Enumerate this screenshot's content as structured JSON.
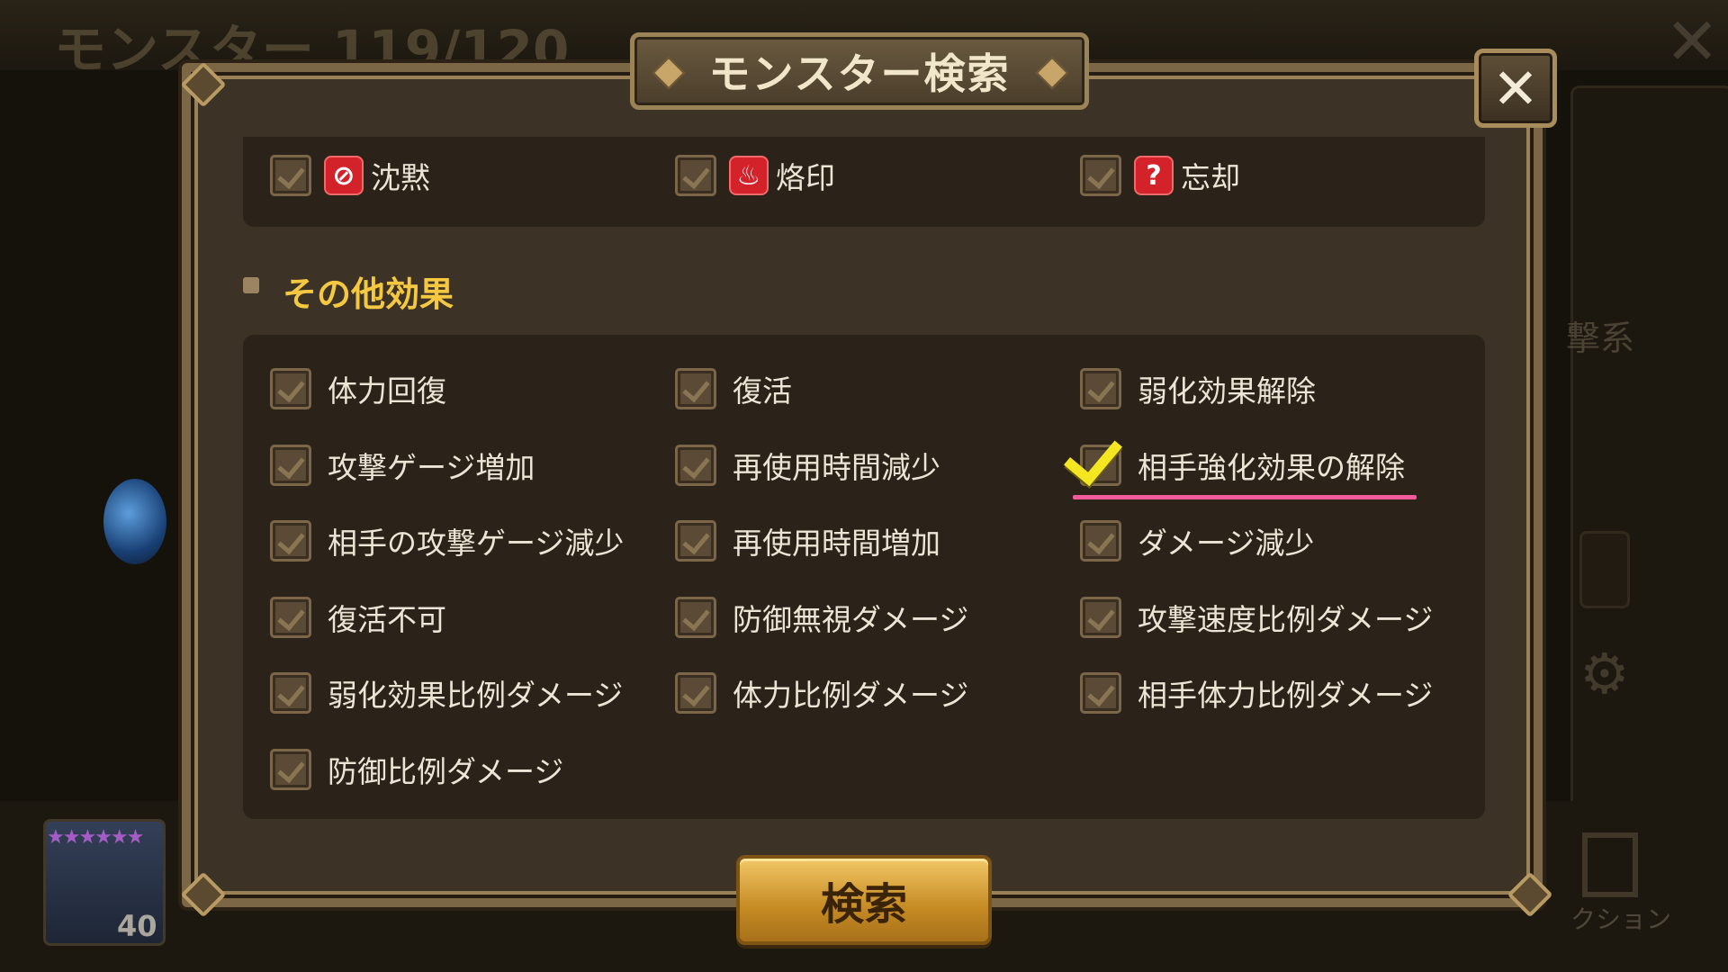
{
  "background": {
    "title": "モンスター 119/120",
    "right_text": "撃系",
    "action_label": "クション",
    "monster_level": "40"
  },
  "dialog": {
    "title": "モンスター検索",
    "close_label": "✕",
    "search_button": "検索"
  },
  "debuffs": [
    {
      "label": "沈黙",
      "icon": "silence-icon",
      "glyph": "⊘",
      "checked": false
    },
    {
      "label": "烙印",
      "icon": "brand-icon",
      "glyph": "♨",
      "checked": false
    },
    {
      "label": "忘却",
      "icon": "oblivion-icon",
      "glyph": "?",
      "checked": false
    }
  ],
  "other_effects": {
    "section_title": "その他効果",
    "items": [
      {
        "label": "体力回復",
        "checked": false
      },
      {
        "label": "復活",
        "checked": false
      },
      {
        "label": "弱化効果解除",
        "checked": false
      },
      {
        "label": "攻撃ゲージ増加",
        "checked": false
      },
      {
        "label": "再使用時間減少",
        "checked": false
      },
      {
        "label": "相手強化効果の解除",
        "checked": true
      },
      {
        "label": "相手の攻撃ゲージ減少",
        "checked": false
      },
      {
        "label": "再使用時間増加",
        "checked": false
      },
      {
        "label": "ダメージ減少",
        "checked": false
      },
      {
        "label": "復活不可",
        "checked": false
      },
      {
        "label": "防御無視ダメージ",
        "checked": false
      },
      {
        "label": "攻撃速度比例ダメージ",
        "checked": false
      },
      {
        "label": "弱化効果比例ダメージ",
        "checked": false
      },
      {
        "label": "体力比例ダメージ",
        "checked": false
      },
      {
        "label": "相手体力比例ダメージ",
        "checked": false
      },
      {
        "label": "防御比例ダメージ",
        "checked": false
      }
    ]
  },
  "colors": {
    "section_title": "#f5c842",
    "highlight_underline": "#f25a9a",
    "check_mark": "#f4e722",
    "debuff_icon": "#d4222a"
  }
}
